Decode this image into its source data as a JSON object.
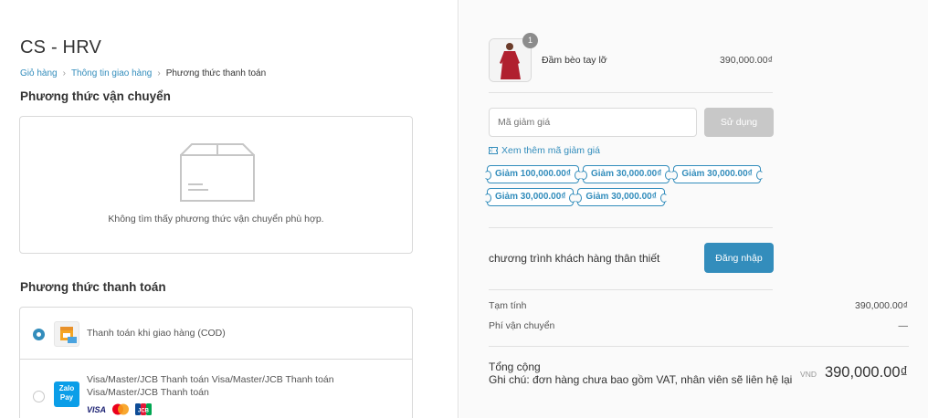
{
  "shop": {
    "title": "CS - HRV"
  },
  "breadcrumb": {
    "items": [
      "Giỏ hàng",
      "Thông tin giao hàng",
      "Phương thức thanh toán"
    ],
    "separator": "›"
  },
  "shipping": {
    "title": "Phương thức vận chuyển",
    "empty_text": "Không tìm thấy phương thức vận chuyển phù hợp.",
    "empty_icon": "empty-box-icon"
  },
  "payment": {
    "title": "Phương thức thanh toán",
    "methods": [
      {
        "label": "Thanh toán khi giao hàng (COD)",
        "selected": true,
        "icon": "cod-icon"
      },
      {
        "label": "Visa/Master/JCB Thanh toán Visa/Master/JCB Thanh toán Visa/Master/JCB Thanh toán",
        "selected": false,
        "icon": "zalopay-icon",
        "icon_text_1": "Zalo",
        "icon_text_2": "Pay"
      }
    ],
    "card_logos": {
      "visa": "VISA",
      "jcb": "JCB"
    }
  },
  "order": {
    "product": {
      "name": "Đầm bèo tay lỡ",
      "quantity": "1",
      "price": "390,000.00₫"
    },
    "discount": {
      "placeholder": "Mã giảm giá",
      "apply_label": "Sử dụng",
      "more_label": "Xem thêm mã giảm giá",
      "coupons": [
        "Giảm 100,000.00₫",
        "Giảm 30,000.00₫",
        "Giảm 30,000.00₫",
        "Giảm 30,000.00₫",
        "Giảm 30,000.00₫"
      ]
    },
    "loyalty": {
      "text": "chương trình khách hàng thân thiết",
      "login_label": "Đăng nhập"
    },
    "summary": {
      "subtotal_label": "Tạm tính",
      "subtotal_value": "390,000.00₫",
      "shipping_label": "Phí vận chuyển",
      "shipping_value": "—",
      "total_label": "Tổng cộng",
      "note": "Ghi chú: đơn hàng chưa bao gồm VAT, nhân viên sẽ liên hệ lại",
      "currency": "VND",
      "total_value": "390,000.00₫"
    }
  },
  "colors": {
    "accent": "#338dbc",
    "disabled_button": "#c8c8c8",
    "sidebar_bg": "#fafafa"
  }
}
